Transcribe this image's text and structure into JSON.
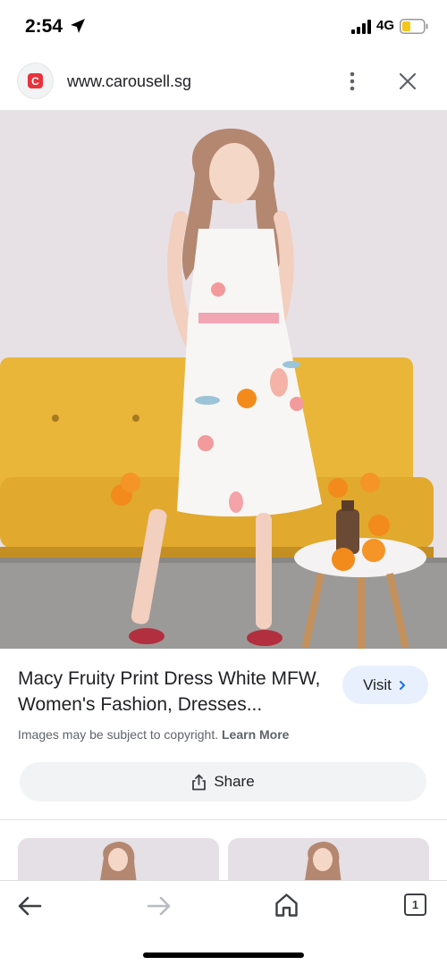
{
  "status_bar": {
    "time": "2:54",
    "network": "4G",
    "icons": [
      "location-arrow-icon",
      "signal-icon",
      "battery-icon"
    ]
  },
  "header": {
    "favicon_letter": "C",
    "url": "www.carousell.sg",
    "icons": [
      "more-vertical-icon",
      "close-icon"
    ]
  },
  "result": {
    "title": "Macy Fruity Print Dress White MFW, Women's Fashion, Dresses...",
    "visit_label": "Visit",
    "copyright_text": "Images may be subject to copyright.",
    "learn_more": "Learn More",
    "share_label": "Share"
  },
  "bottom_nav": {
    "tab_count": "1",
    "icons": [
      "back-arrow-icon",
      "forward-arrow-icon",
      "home-icon",
      "tabs-icon"
    ]
  },
  "colors": {
    "accent_visit_bg": "#e8f0fe",
    "share_bg": "#f1f3f4",
    "favicon_red": "#e8323c",
    "sofa_yellow": "#e9b63a",
    "wall": "#e7e1e6"
  }
}
